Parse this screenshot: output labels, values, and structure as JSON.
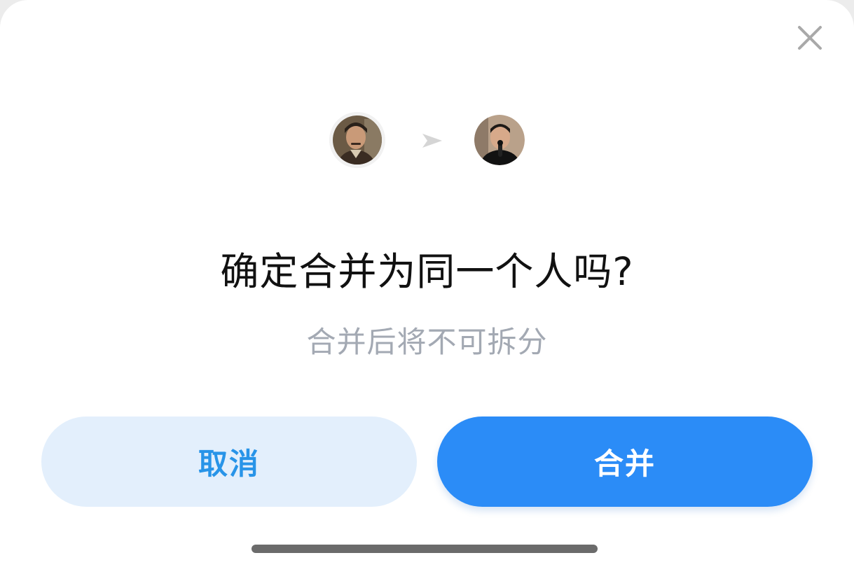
{
  "dialog": {
    "title": "确定合并为同一个人吗?",
    "subtitle": "合并后将不可拆分",
    "cancel_label": "取消",
    "confirm_label": "合并"
  },
  "icons": {
    "close": "close-icon",
    "arrow": "arrow-right-icon",
    "source_avatar": "person-avatar",
    "target_avatar": "person-avatar"
  },
  "colors": {
    "primary": "#2b8cf7",
    "cancel_bg": "#e3effc",
    "cancel_text": "#2894e8",
    "title_text": "#111111",
    "subtitle_text": "#a3a9b3"
  }
}
